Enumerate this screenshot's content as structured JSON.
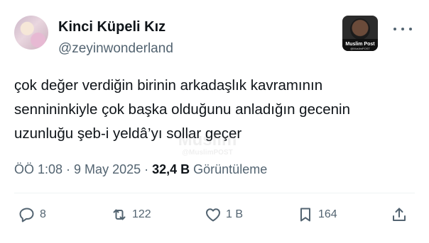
{
  "user": {
    "display_name": "Kinci Küpeli Kız",
    "handle": "@zeyinwonderland"
  },
  "extension_badge": {
    "name": "Muslim Post",
    "sub": "@MuslimPOST"
  },
  "tweet": {
    "lines": [
      "çok değer verdiğin birinin arkadaşlık kavramının",
      "sennininkiyle çok başka olduğunu anladığın gecenin",
      "uzunluğu şeb-i yeldâ’yı sollar geçer"
    ]
  },
  "watermark": {
    "line1": "Muslim",
    "line2": "@MuslimPOST"
  },
  "meta": {
    "time": "ÖÖ 1:08",
    "sep1": " · ",
    "date": "9 May 2025",
    "sep2": " · ",
    "views_count": "32,4 B",
    "views_label": " Görüntüleme"
  },
  "actions": {
    "replies": "8",
    "reposts": "122",
    "likes": "1 B",
    "bookmarks": "164"
  },
  "icons": {
    "more": "more-horizontal-icon",
    "reply": "reply-icon",
    "repost": "repost-icon",
    "like": "heart-icon",
    "bookmark": "bookmark-icon",
    "share": "share-icon"
  },
  "colors": {
    "text": "#0f1419",
    "secondary": "#536471",
    "divider": "#eff3f4"
  }
}
